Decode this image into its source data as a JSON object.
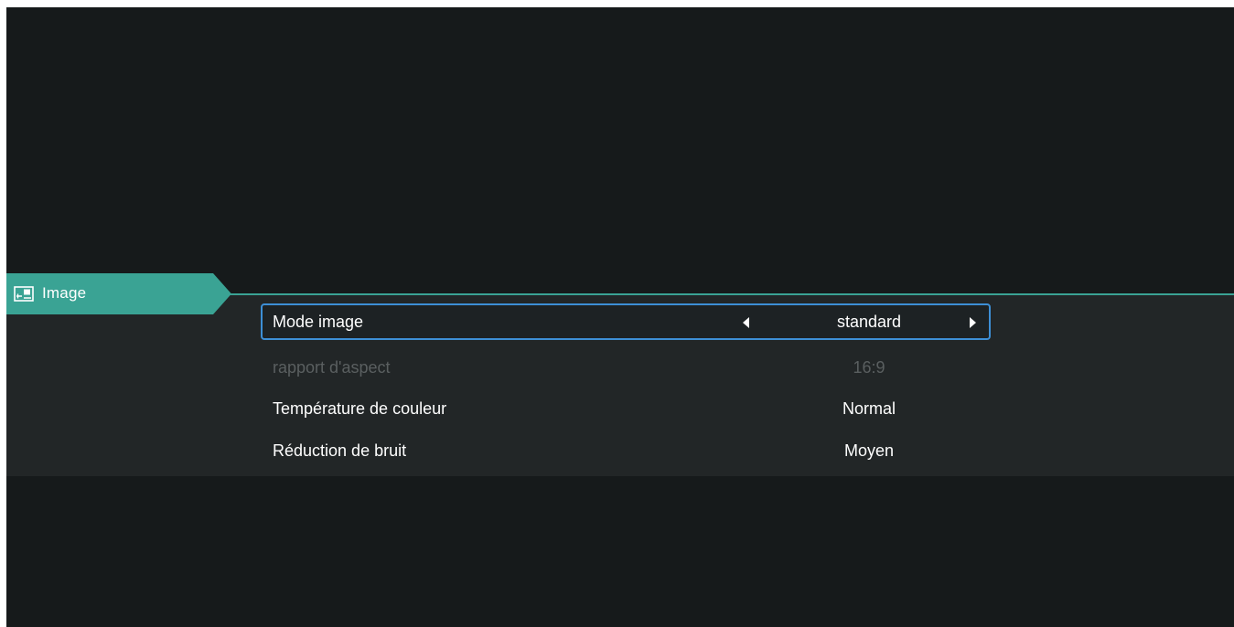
{
  "category": {
    "label": "Image",
    "icon": "picture-settings-icon",
    "accent_color": "#3aa394"
  },
  "settings": [
    {
      "label": "Mode image",
      "value": "standard",
      "focused": true,
      "disabled": false
    },
    {
      "label": "rapport d'aspect",
      "value": "16:9",
      "focused": false,
      "disabled": true
    },
    {
      "label": "Température de couleur",
      "value": "Normal",
      "focused": false,
      "disabled": false
    },
    {
      "label": "Réduction de bruit",
      "value": "Moyen",
      "focused": false,
      "disabled": false
    }
  ],
  "focus_color": "#3d8fd6"
}
